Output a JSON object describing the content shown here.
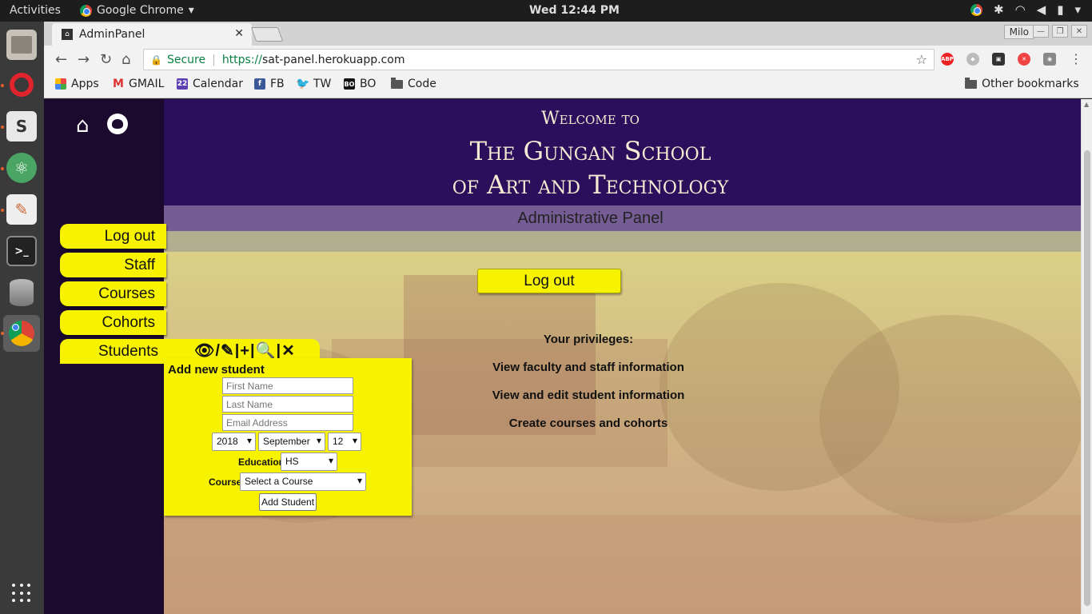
{
  "topbar": {
    "activities": "Activities",
    "app_name": "Google Chrome",
    "clock": "Wed 12:44 PM"
  },
  "dock": {
    "items": [
      "files-icon",
      "opera-icon",
      "slack-icon",
      "atom-icon",
      "text-editor-icon",
      "terminal-icon",
      "database-icon",
      "chrome-icon"
    ]
  },
  "browser": {
    "tab_title": "AdminPanel",
    "profile": "Milo",
    "secure_label": "Secure",
    "url_scheme": "https://",
    "url_host": "sat-panel.herokuapp.com",
    "bookmarks": [
      {
        "label": "Apps",
        "icon": "apps-grid-icon"
      },
      {
        "label": "GMAIL",
        "icon": "gmail-icon"
      },
      {
        "label": "Calendar",
        "icon": "calendar-icon"
      },
      {
        "label": "FB",
        "icon": "facebook-icon"
      },
      {
        "label": "TW",
        "icon": "twitter-icon"
      },
      {
        "label": "BO",
        "icon": "bo-icon"
      },
      {
        "label": "Code",
        "icon": "folder-icon"
      }
    ],
    "other_bookmarks": "Other bookmarks",
    "calendar_day": "22",
    "bo_badge": "BO",
    "abp_badge": "ABP"
  },
  "page": {
    "welcome": "Welcome to",
    "school_line1": "The Gungan School",
    "school_line2": "of Art and Technology",
    "admin_title": "Administrative Panel",
    "nav": {
      "logout": "Log out",
      "staff": "Staff",
      "courses": "Courses",
      "cohorts": "Cohorts",
      "students": "Students",
      "students_tools": "👁/✎|+|🔍|✕"
    },
    "main_logout": "Log out",
    "privileges_title": "Your privileges:",
    "privileges": [
      "View faculty and staff information",
      "View and edit student information",
      "Create courses and cohorts"
    ],
    "form": {
      "title": "Add new student",
      "first_name_placeholder": "First Name",
      "last_name_placeholder": "Last Name",
      "email_placeholder": "Email Address",
      "year": "2018",
      "month": "September",
      "day": "12",
      "education_label": "Education:",
      "education_value": "HS",
      "course_label": "Course:",
      "course_value": "Select a Course",
      "submit": "Add Student"
    }
  },
  "colors": {
    "sidebar": "#1c0a2e",
    "header": "#2a0f5c",
    "button_yellow": "#f7f200",
    "header_text": "#f4ecd2"
  }
}
